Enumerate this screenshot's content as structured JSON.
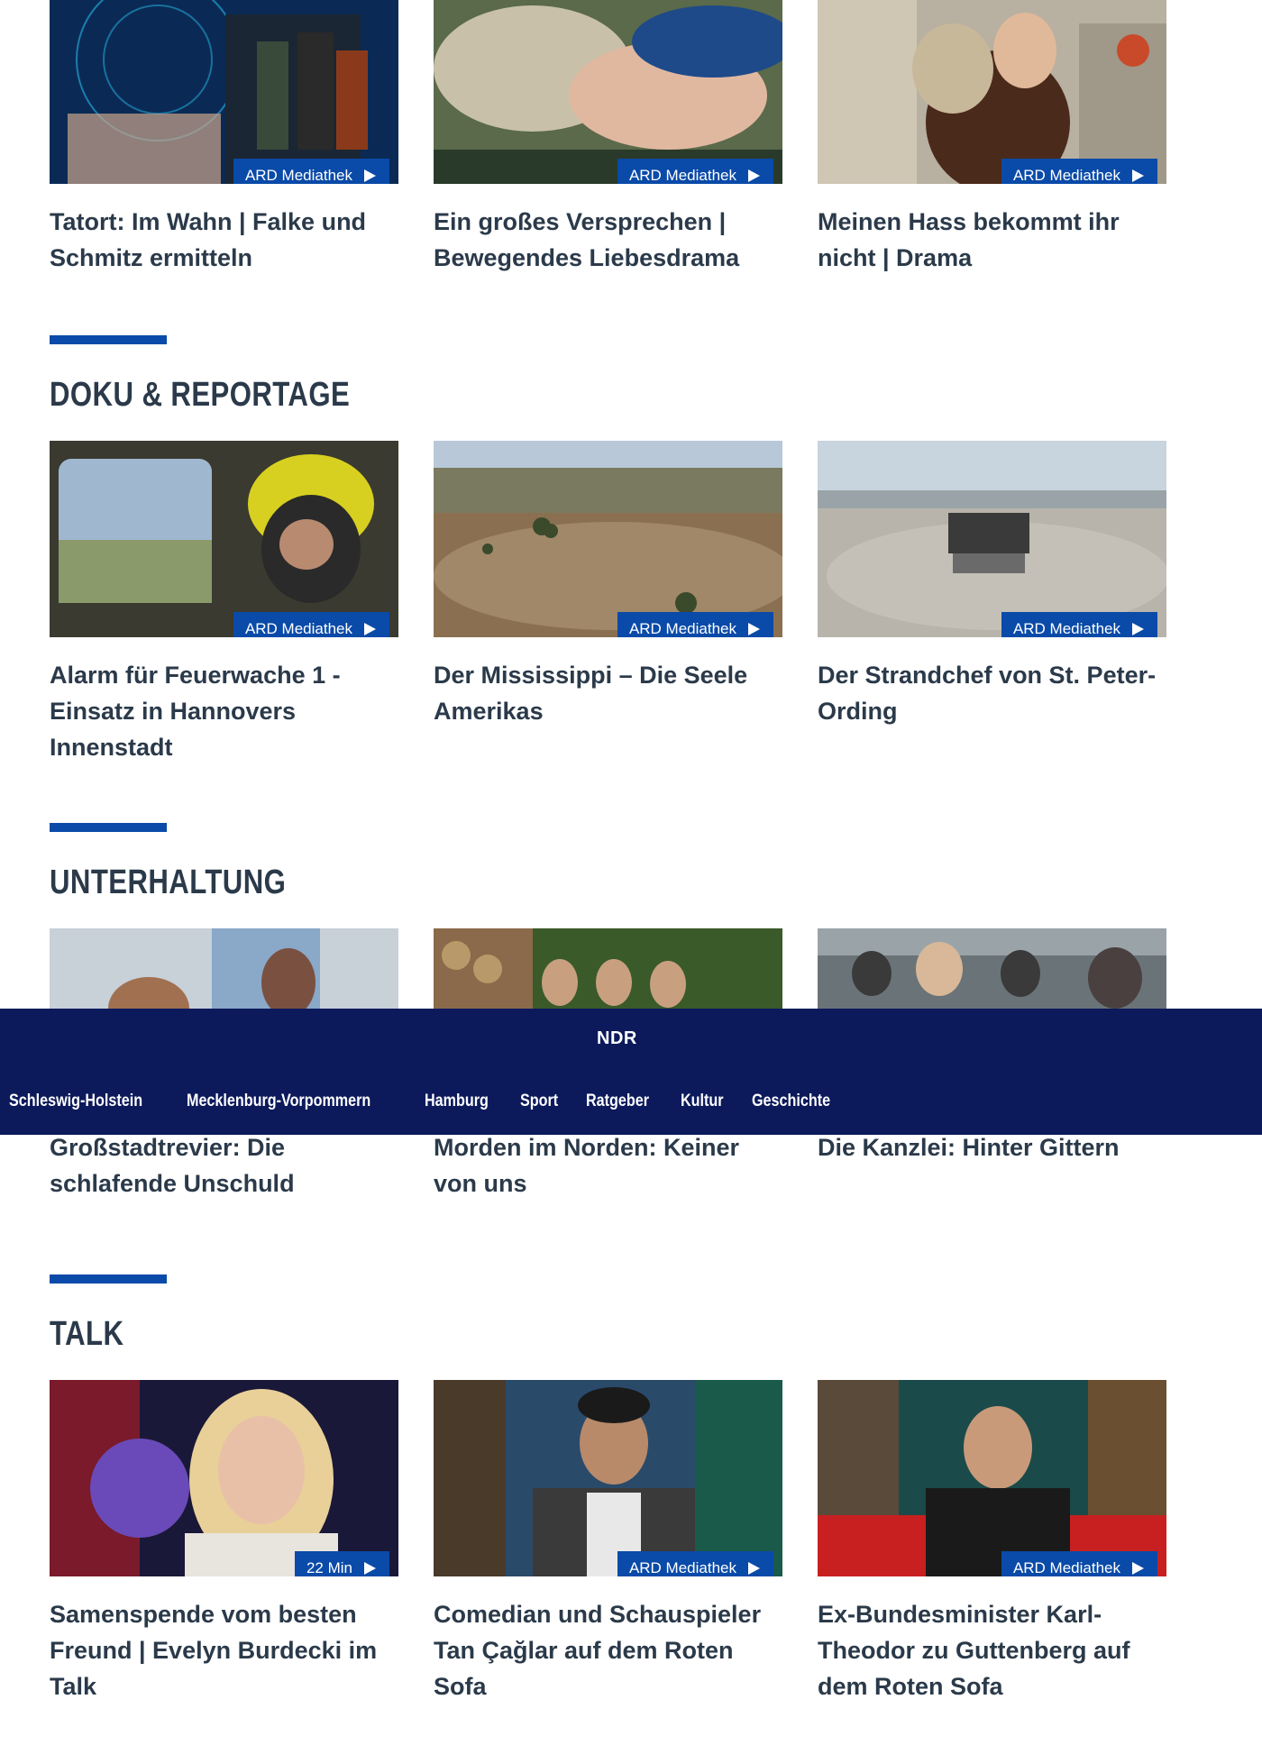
{
  "sections": [
    {
      "title": "",
      "cards": [
        {
          "title": "Tatort: Im Wahn | Falke und Schmitz ermitteln",
          "badge": "ARD Mediathek"
        },
        {
          "title": "Ein großes Versprechen | Bewegendes Liebesdrama",
          "badge": "ARD Mediathek"
        },
        {
          "title": "Meinen Hass bekommt ihr nicht | Drama",
          "badge": "ARD Mediathek"
        }
      ]
    },
    {
      "title": "DOKU & REPORTAGE",
      "cards": [
        {
          "title": "Alarm für Feuerwache 1 - Einsatz in Hannovers Innenstadt",
          "badge": "ARD Mediathek"
        },
        {
          "title": "Der Mississippi – Die Seele Amerikas",
          "badge": "ARD Mediathek"
        },
        {
          "title": "Der Strandchef von St. Peter-Ording",
          "badge": "ARD Mediathek"
        }
      ]
    },
    {
      "title": "UNTERHALTUNG",
      "cards": [
        {
          "title": "Großstadtrevier: Die schlafende Unschuld"
        },
        {
          "title": "Morden im Norden: Keiner von uns"
        },
        {
          "title": "Die Kanzlei: Hinter Gittern"
        }
      ]
    },
    {
      "title": "TALK",
      "cards": [
        {
          "title": "Samenspende vom besten Freund | Evelyn Burdecki im Talk",
          "badge": "22 Min"
        },
        {
          "title": "Comedian und Schauspieler Tan Çağlar auf dem Roten Sofa",
          "badge": "ARD Mediathek"
        },
        {
          "title": "Ex-Bundesminister Karl-Theodor zu Guttenberg auf dem Roten Sofa",
          "badge": "ARD Mediathek"
        }
      ]
    }
  ],
  "ndr_bar": {
    "logo": "NDR",
    "nav": [
      "Schleswig-Holstein",
      "Mecklenburg-Vorpommern",
      "Hamburg",
      "Sport",
      "Ratgeber",
      "Kultur",
      "Geschichte"
    ]
  },
  "colors": {
    "accent": "#0a4aa8",
    "ndr_navy": "#0c1a5c",
    "text": "#2b3a4a"
  }
}
